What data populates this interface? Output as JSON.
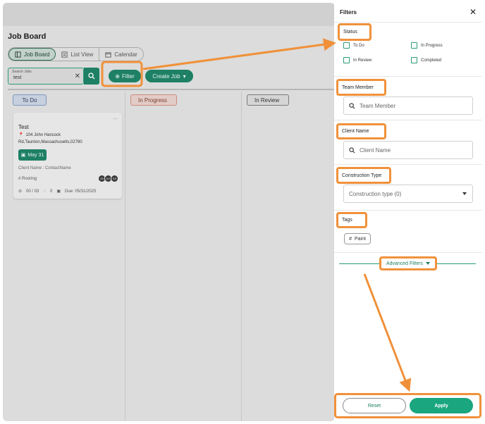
{
  "board": {
    "title": "Job Board",
    "view_tabs": [
      {
        "label": "Job Board",
        "icon": "board-icon",
        "active": true
      },
      {
        "label": "List View",
        "icon": "list-icon",
        "active": false
      },
      {
        "label": "Calendar",
        "icon": "calendar-icon",
        "active": false
      }
    ],
    "search": {
      "label": "Search Jobs",
      "value": "test",
      "clear_icon": "close-icon"
    },
    "filter_button": "Filter",
    "create_job_button": "Create Job",
    "columns": [
      "To Do",
      "In Progress",
      "In Review"
    ],
    "card": {
      "title": "Test",
      "address_line1": "104 John Hancock",
      "address_line2": "Rd,Taunton,Massachusetts,02780",
      "date_badge": "May 31",
      "client": "Client Name : ContactName",
      "tag": "# Rooring",
      "avatars": [
        "ZB",
        "AG",
        "KB"
      ],
      "checklist": "00 / 03",
      "comments": "0",
      "due": "Due: 05/31/2025",
      "menu": "..."
    }
  },
  "panel": {
    "title": "Filters",
    "close": "✕",
    "status": {
      "label": "Status",
      "options": [
        "To Do",
        "In Progress",
        "In Review",
        "Completed"
      ]
    },
    "team_member": {
      "label": "Team Member",
      "placeholder": "Team Member"
    },
    "client_name": {
      "label": "Client Name",
      "placeholder": "Client Name"
    },
    "construction_type": {
      "label": "Construction Type",
      "value": "Construction type (0)"
    },
    "tags": {
      "label": "Tags",
      "chips": [
        "Paint"
      ]
    },
    "advanced_filters": "Advanced Filters",
    "reset": "Reset",
    "apply": "Apply"
  },
  "colors": {
    "accent": "#1e8064",
    "apply": "#1aa67f",
    "highlight": "#f0913a",
    "overlay": "#dcdcdc"
  }
}
